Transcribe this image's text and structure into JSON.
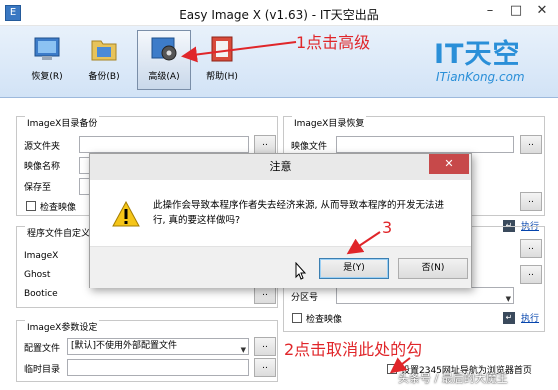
{
  "window": {
    "title": "Easy Image X (v1.63) - IT天空出品",
    "minimize_glyph": "–",
    "maximize_glyph": "□",
    "close_glyph": "✕"
  },
  "toolbar": {
    "buttons": [
      {
        "label": "恢复(R)",
        "icon": "restore-icon"
      },
      {
        "label": "备份(B)",
        "icon": "backup-icon"
      },
      {
        "label": "高级(A)",
        "icon": "advanced-icon"
      },
      {
        "label": "帮助(H)",
        "icon": "help-icon"
      }
    ]
  },
  "logo": {
    "main": "IT天空",
    "sub": "ITianKong.com"
  },
  "annotations": {
    "step1": "1点击高级",
    "step2": "2点击取消此处的勾",
    "step3": "3"
  },
  "backup_group": {
    "title": "ImageX目录备份",
    "source_label": "源文件夹",
    "image_name_label": "映像名称",
    "save_to_label": "保存至",
    "check_image_label": "检查映像",
    "browse": ".."
  },
  "restore_group": {
    "title": "ImageX目录恢复",
    "image_file_label": "映像文件",
    "check_image_label": "检查映像",
    "execute": "执行",
    "browse": ".."
  },
  "program_group": {
    "title": "程序文件自定义",
    "imagex_label": "ImageX",
    "ghost_label": "Ghost",
    "bootice_label": "Bootice",
    "browse": ".."
  },
  "param_group": {
    "title": "ImageX参数设定",
    "config_label": "配置文件",
    "config_value": "[默认]不使用外部配置文件",
    "temp_dir_label": "临时目录",
    "browse": ".."
  },
  "right_lower": {
    "partition_label": "分区号",
    "check_image_label": "检查映像",
    "execute": "执行",
    "homepage_label": "设置2345网址导航为浏览器首页"
  },
  "dialog": {
    "title": "注意",
    "message": "此操作会导致本程序作者失去经济来源, 从而导致本程序的开发无法进行, 真的要这样做吗?",
    "yes": "是(Y)",
    "no": "否(N)",
    "close_glyph": "✕"
  },
  "watermark": "头条号 / 最后的大魔王",
  "colors": {
    "accent": "#2a8fd8",
    "annotation": "#e0262a",
    "close": "#c7494a"
  }
}
